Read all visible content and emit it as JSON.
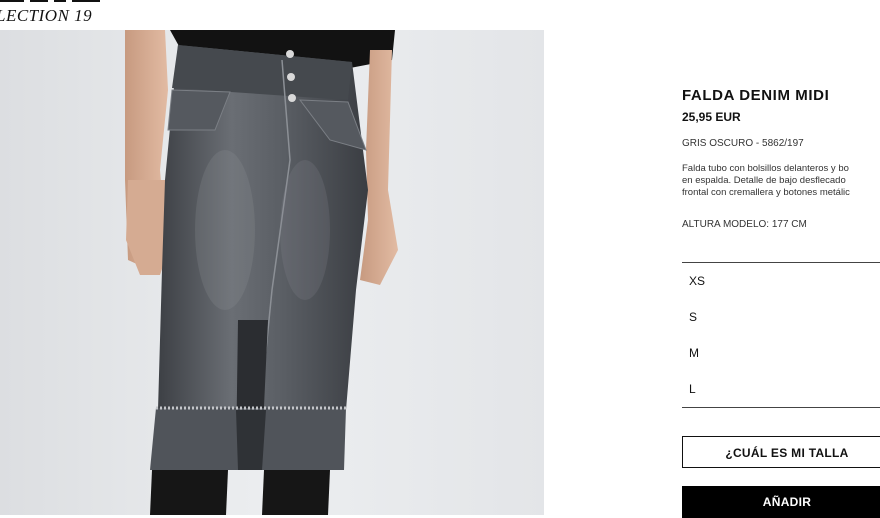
{
  "brand": {
    "collection_label": "LECTION 19"
  },
  "product": {
    "title": "FALDA DENIM MIDI",
    "price": "25,95 EUR",
    "color_ref": "GRIS OSCURO - 5862/197",
    "description": "Falda tubo con bolsillos delanteros y bo\nen espalda. Detalle de bajo desflecado\nfrontal con cremallera y botones metálic",
    "model_height": "ALTURA MODELO: 177 CM"
  },
  "sizes": [
    "XS",
    "S",
    "M",
    "L"
  ],
  "actions": {
    "size_guide_label": "¿CUÁL ES MI TALLA",
    "add_label": "AÑADIR"
  },
  "colors": {
    "accent": "#000000",
    "image_background": "#e7e8ea",
    "denim": "#4f5257"
  }
}
